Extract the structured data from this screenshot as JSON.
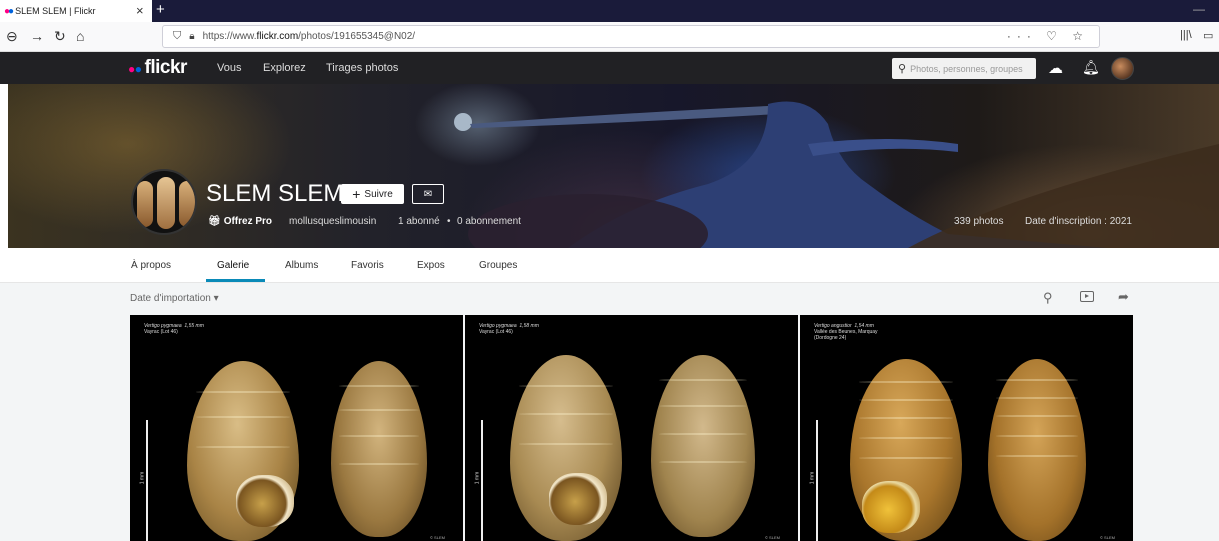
{
  "browser": {
    "tab_title": "SLEM SLEM | Flickr",
    "url_domain": "flickr.com",
    "url_prefix": "https://www.",
    "url_path": "/photos/191655345@N02/",
    "url_actions": "··· ♡ ☆"
  },
  "header": {
    "logo": "flickr",
    "nav": [
      "Vous",
      "Explorez",
      "Tirages photos"
    ],
    "search_placeholder": "Photos, personnes, groupes"
  },
  "profile": {
    "name": "SLEM SLEM",
    "follow_label": "Suivre",
    "pro_label": "Offrez Pro",
    "username": "mollusqueslimousin",
    "followers": "1 abonné",
    "separator": "•",
    "following": "0 abonnement",
    "photo_count": "339 photos",
    "join_date": "Date d'inscription : 2021"
  },
  "subnav": {
    "tabs": [
      "À propos",
      "Galerie",
      "Albums",
      "Favoris",
      "Expos",
      "Groupes"
    ],
    "active": "Galerie"
  },
  "gallery": {
    "sort_label": "Date d'importation ▾",
    "photos": [
      {
        "species": "Vertigo pygmaea",
        "size": "1,55 mm",
        "locality": "Vayrac (Lot 46)",
        "scale": "1 mm",
        "credit": "© SLEM"
      },
      {
        "species": "Vertigo pygmaea",
        "size": "1,58 mm",
        "locality": "Vayrac (Lot 46)",
        "scale": "1 mm",
        "credit": "© SLEM"
      },
      {
        "species": "Vertigo angustior",
        "size": "1,54 mm",
        "locality": "Vallée des Beunes, Marquay\n(Dordogne 24)",
        "scale": "1 mm",
        "credit": "© SLEM"
      }
    ]
  }
}
